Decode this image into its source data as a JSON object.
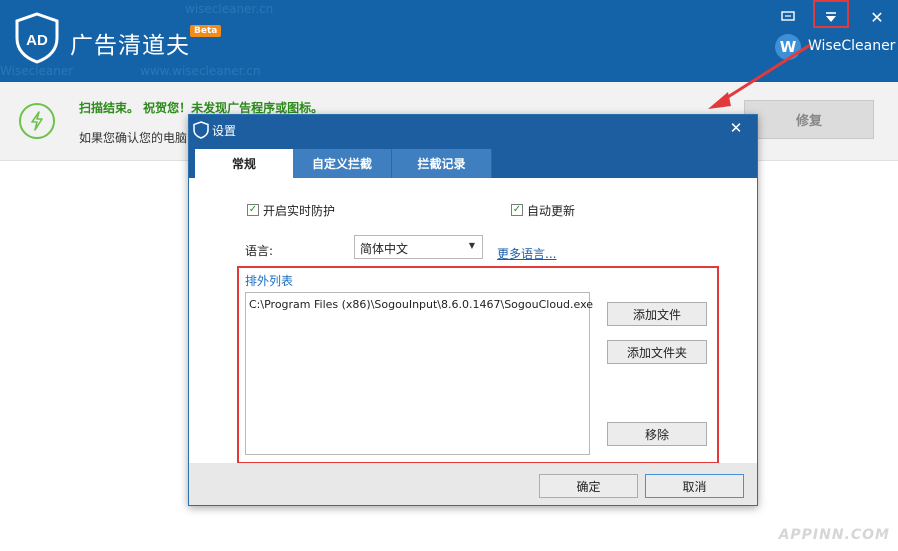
{
  "app": {
    "title": "广告清道夫",
    "badge": "Beta",
    "brand": "WiseCleaner",
    "brand_initial": "W",
    "logo_text": "AD"
  },
  "header_icons": {
    "feedback": "feedback-icon",
    "menu": "menu-dropdown-icon",
    "close": "close-icon"
  },
  "background_ghost_text": [
    "wisecleaner.cn",
    "Wisecleaner",
    "www.wisecleaner.cn"
  ],
  "status": {
    "title": "扫描结束。 祝贺您！未发现广告程序或图标。",
    "desc": "如果您确认您的电脑",
    "repair_label": "修复"
  },
  "dialog": {
    "title": "设置",
    "tabs": [
      {
        "label": "常规",
        "active": true
      },
      {
        "label": "自定义拦截",
        "active": false
      },
      {
        "label": "拦截记录",
        "active": false
      }
    ],
    "realtime_label": "开启实时防护",
    "realtime_checked": true,
    "autoupdate_label": "自动更新",
    "autoupdate_checked": true,
    "language_label": "语言:",
    "language_value": "简体中文",
    "more_languages": "更多语言...",
    "exclusion_title": "排外列表",
    "exclusion_items": [
      "C:\\Program Files (x86)\\SogouInput\\8.6.0.1467\\SogouCloud.exe"
    ],
    "add_file": "添加文件",
    "add_folder": "添加文件夹",
    "remove": "移除",
    "ok": "确定",
    "cancel": "取消"
  },
  "watermark": "APPINN.COM",
  "colors": {
    "header_bg": "#1462a8",
    "dialog_title_bg": "#1c5ea0",
    "tab_inactive_bg": "#3f7fc0",
    "status_green": "#2d8a1c",
    "highlight_red": "#e23a3a",
    "beta_orange": "#f28b1a"
  }
}
